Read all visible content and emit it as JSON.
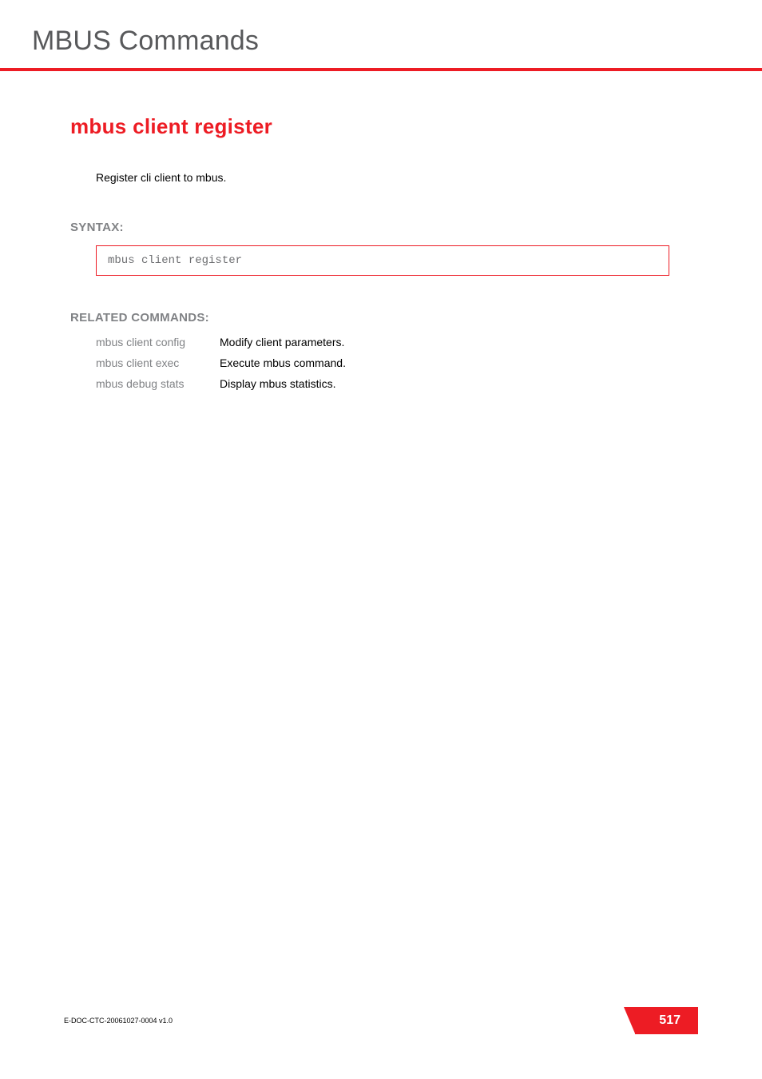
{
  "header": {
    "chapter_title": "MBUS Commands"
  },
  "main": {
    "command_heading": "mbus client register",
    "description": "Register cli client to mbus.",
    "syntax_label": "SYNTAX:",
    "syntax_code": "mbus client register",
    "related_label": "RELATED COMMANDS:",
    "related": [
      {
        "cmd": "mbus client config",
        "desc": "Modify client parameters."
      },
      {
        "cmd": "mbus client exec",
        "desc": "Execute mbus command."
      },
      {
        "cmd": "mbus debug stats",
        "desc": "Display mbus statistics."
      }
    ]
  },
  "footer": {
    "doc_id": "E-DOC-CTC-20061027-0004 v1.0",
    "page_number": "517"
  }
}
